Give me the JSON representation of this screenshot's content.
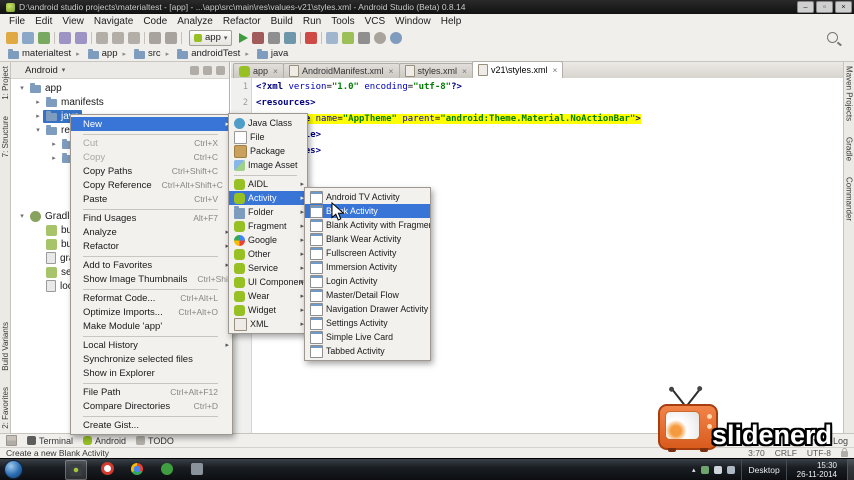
{
  "window": {
    "title": "D:\\android studio projects\\materialtest - [app] - ...\\app\\src\\main\\res\\values-v21\\styles.xml - Android Studio (Beta) 0.8.14",
    "minimize": "–",
    "maximize": "▫",
    "close": "×"
  },
  "menubar": {
    "items": [
      {
        "label": "File"
      },
      {
        "label": "Edit"
      },
      {
        "label": "View"
      },
      {
        "label": "Navigate"
      },
      {
        "label": "Code"
      },
      {
        "label": "Analyze"
      },
      {
        "label": "Refactor"
      },
      {
        "label": "Build"
      },
      {
        "label": "Run"
      },
      {
        "label": "Tools"
      },
      {
        "label": "VCS"
      },
      {
        "label": "Window"
      },
      {
        "label": "Help"
      }
    ]
  },
  "toolbar": {
    "run_config": "app",
    "left_icons": [
      {
        "name": "open"
      },
      {
        "name": "save"
      },
      {
        "name": "sync"
      },
      {
        "sep": true
      },
      {
        "name": "undo"
      },
      {
        "name": "redo"
      },
      {
        "sep": true
      },
      {
        "name": "cut"
      },
      {
        "name": "copy"
      },
      {
        "name": "paste"
      },
      {
        "sep": true
      },
      {
        "name": "back"
      },
      {
        "name": "forward"
      },
      {
        "sep": true
      }
    ],
    "right_icons": [
      {
        "name": "run"
      },
      {
        "name": "debug"
      },
      {
        "name": "coverage"
      },
      {
        "name": "profiler"
      },
      {
        "sep": true
      },
      {
        "name": "stop"
      },
      {
        "sep": true
      },
      {
        "name": "avd"
      },
      {
        "name": "sdk"
      },
      {
        "name": "monitor"
      },
      {
        "name": "gear"
      },
      {
        "name": "help"
      }
    ]
  },
  "breadcrumb": {
    "items": [
      {
        "label": "materialtest",
        "icon": "folder"
      },
      {
        "label": "app",
        "icon": "folder"
      },
      {
        "label": "src",
        "icon": "folder"
      },
      {
        "label": "androidTest",
        "icon": "folder"
      },
      {
        "label": "java",
        "icon": "folder"
      }
    ]
  },
  "left_strip": {
    "top": [
      {
        "label": "1: Project"
      },
      {
        "label": "7: Structure"
      }
    ],
    "bottom": [
      {
        "label": "Build Variants"
      },
      {
        "label": "2: Favorites"
      }
    ]
  },
  "right_strip": {
    "items": [
      {
        "label": "Maven Projects"
      },
      {
        "label": "Gradle"
      },
      {
        "label": "Commander"
      }
    ]
  },
  "project_panel": {
    "view": "Android",
    "tree": [
      {
        "label": "app",
        "icon": "folder",
        "exp": "▾"
      },
      {
        "label": "manifests",
        "icon": "folder",
        "exp": "▸",
        "indent1": true
      },
      {
        "label": "java",
        "icon": "folder",
        "exp": "▸",
        "indent1": true,
        "selected": true
      },
      {
        "label": "res",
        "icon": "folder",
        "exp": "▾",
        "indent1": true
      },
      {
        "label": "",
        "icon": "folder",
        "exp": "▸",
        "indent2": true
      },
      {
        "label": "",
        "icon": "folder",
        "exp": "▸",
        "indent2": true
      },
      {
        "label": "Gradle Scripts",
        "icon": "gradle",
        "exp": "▾",
        "gap": true
      },
      {
        "label": "build.gradle",
        "icon": "gradlefile",
        "indent1": true
      },
      {
        "label": "build.gradle",
        "icon": "gradlefile",
        "indent1": true
      },
      {
        "label": "gradle.properties",
        "icon": "propfile",
        "indent1": true
      },
      {
        "label": "settings.gradle",
        "icon": "gradlefile",
        "indent1": true
      },
      {
        "label": "local.properties",
        "icon": "propfile",
        "indent1": true
      }
    ]
  },
  "editor": {
    "tabs": [
      {
        "label": "app",
        "icon": "android"
      },
      {
        "label": "AndroidManifest.xml",
        "icon": "xml"
      },
      {
        "label": "styles.xml",
        "icon": "xml"
      },
      {
        "label": "v21\\styles.xml",
        "icon": "xml",
        "selected": true
      }
    ],
    "lines": [
      {
        "num": "1",
        "segments": [
          {
            "t": "<?xml ",
            "c": "tag"
          },
          {
            "t": "version",
            "c": "attr"
          },
          {
            "t": "=",
            "c": "plain"
          },
          {
            "t": "\"1.0\"",
            "c": "val"
          },
          {
            "t": " ",
            "c": "plain"
          },
          {
            "t": "encoding",
            "c": "attr"
          },
          {
            "t": "=",
            "c": "plain"
          },
          {
            "t": "\"utf-8\"",
            "c": "val"
          },
          {
            "t": "?>",
            "c": "tag"
          }
        ]
      },
      {
        "num": "2",
        "segments": [
          {
            "t": "<resources>",
            "c": "tag"
          }
        ]
      },
      {
        "num": "3",
        "highlight": true,
        "segments": [
          {
            "t": "    ",
            "c": "plain"
          },
          {
            "t": "<style ",
            "c": "tag"
          },
          {
            "t": "name",
            "c": "attr"
          },
          {
            "t": "=",
            "c": "plain"
          },
          {
            "t": "\"AppTheme\"",
            "c": "val"
          },
          {
            "t": " ",
            "c": "plain"
          },
          {
            "t": "parent",
            "c": "attr"
          },
          {
            "t": "=",
            "c": "plain"
          },
          {
            "t": "\"android:Theme.Material.NoActionBar\"",
            "c": "val"
          },
          {
            "t": ">",
            "c": "tag"
          }
        ]
      },
      {
        "num": "4",
        "segments": [
          {
            "t": "    ",
            "c": "plain"
          },
          {
            "t": "</style>",
            "c": "tag"
          }
        ]
      },
      {
        "num": "5",
        "segments": [
          {
            "t": "</resources>",
            "c": "tag"
          }
        ]
      }
    ]
  },
  "context_menu": {
    "items": [
      {
        "label": "New",
        "submenu": true,
        "selected": true
      },
      {
        "separator": true
      },
      {
        "label": "Cut",
        "shortcut": "Ctrl+X",
        "disabled": true
      },
      {
        "label": "Copy",
        "shortcut": "Ctrl+C",
        "disabled": true
      },
      {
        "label": "Copy Paths",
        "shortcut": "Ctrl+Shift+C"
      },
      {
        "label": "Copy Reference",
        "shortcut": "Ctrl+Alt+Shift+C"
      },
      {
        "label": "Paste",
        "shortcut": "Ctrl+V"
      },
      {
        "separator": true
      },
      {
        "label": "Find Usages",
        "shortcut": "Alt+F7"
      },
      {
        "label": "Analyze",
        "submenu": true
      },
      {
        "label": "Refactor",
        "submenu": true
      },
      {
        "separator": true
      },
      {
        "label": "Add to Favorites",
        "submenu": true
      },
      {
        "label": "Show Image Thumbnails",
        "shortcut": "Ctrl+Shift+T"
      },
      {
        "separator": true
      },
      {
        "label": "Reformat Code...",
        "shortcut": "Ctrl+Alt+L"
      },
      {
        "label": "Optimize Imports...",
        "shortcut": "Ctrl+Alt+O"
      },
      {
        "label": "Make Module 'app'"
      },
      {
        "separator": true
      },
      {
        "label": "Local History",
        "submenu": true
      },
      {
        "label": "Synchronize selected files"
      },
      {
        "label": "Show in Explorer"
      },
      {
        "separator": true
      },
      {
        "label": "File Path",
        "shortcut": "Ctrl+Alt+F12"
      },
      {
        "label": "Compare Directories",
        "shortcut": "Ctrl+D"
      },
      {
        "separator": true
      },
      {
        "label": "Create Gist..."
      }
    ]
  },
  "new_submenu": {
    "items": [
      {
        "label": "Java Class",
        "icon": "class"
      },
      {
        "label": "File",
        "icon": "file"
      },
      {
        "label": "Package",
        "icon": "package"
      },
      {
        "label": "Image Asset",
        "icon": "image"
      },
      {
        "separator": true
      },
      {
        "label": "AIDL",
        "icon": "android",
        "submenu": true
      },
      {
        "label": "Activity",
        "icon": "android",
        "submenu": true,
        "selected": true
      },
      {
        "label": "Folder",
        "icon": "folder",
        "submenu": true
      },
      {
        "label": "Fragment",
        "icon": "android",
        "submenu": true
      },
      {
        "label": "Google",
        "icon": "google",
        "submenu": true
      },
      {
        "label": "Other",
        "icon": "android",
        "submenu": true
      },
      {
        "label": "Service",
        "icon": "android",
        "submenu": true
      },
      {
        "label": "UI Component",
        "icon": "android",
        "submenu": true
      },
      {
        "label": "Wear",
        "icon": "android",
        "submenu": true
      },
      {
        "label": "Widget",
        "icon": "android",
        "submenu": true
      },
      {
        "label": "XML",
        "icon": "xml",
        "submenu": true
      }
    ]
  },
  "activity_submenu": {
    "items": [
      {
        "label": "Android TV Activity",
        "icon": "tpl"
      },
      {
        "label": "Blank Activity",
        "icon": "tpl",
        "selected": true
      },
      {
        "label": "Blank Activity with Fragment",
        "icon": "tpl"
      },
      {
        "label": "Blank Wear Activity",
        "icon": "tpl"
      },
      {
        "label": "Fullscreen Activity",
        "icon": "tpl"
      },
      {
        "label": "Immersion Activity",
        "icon": "tpl"
      },
      {
        "label": "Login Activity",
        "icon": "tpl"
      },
      {
        "label": "Master/Detail Flow",
        "icon": "tpl"
      },
      {
        "label": "Navigation Drawer Activity",
        "icon": "tpl"
      },
      {
        "label": "Settings Activity",
        "icon": "tpl"
      },
      {
        "label": "Simple Live Card",
        "icon": "tpl"
      },
      {
        "label": "Tabbed Activity",
        "icon": "tpl"
      }
    ]
  },
  "bottom_tools": {
    "items": [
      {
        "label": "Terminal",
        "icon": "terminal"
      },
      {
        "label": "Android",
        "icon": "android"
      },
      {
        "label": "TODO",
        "icon": "todo"
      }
    ],
    "right_label": "Event Log"
  },
  "status_bar": {
    "message": "Create a new Blank Activity",
    "segments": [
      {
        "text": "3:70"
      },
      {
        "text": "CRLF"
      },
      {
        "text": "UTF-8"
      }
    ]
  },
  "taskbar": {
    "apps": [
      {
        "name": "studio"
      },
      {
        "name": "opera"
      },
      {
        "name": "chrome"
      },
      {
        "name": "screen"
      },
      {
        "name": "media"
      }
    ],
    "tray": [
      {
        "name": "shield"
      },
      {
        "name": "volume"
      },
      {
        "name": "network"
      }
    ],
    "desktop_label": "Desktop",
    "time": "15:30",
    "date": "26-11-2014"
  },
  "watermark": {
    "text": "slidenerd"
  }
}
